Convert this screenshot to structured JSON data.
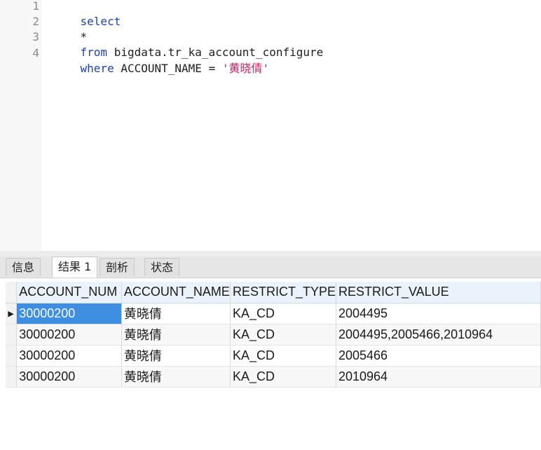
{
  "editor": {
    "line_numbers": [
      "1",
      "2",
      "3",
      "4"
    ],
    "lines": [
      [
        {
          "t": "select",
          "c": "kw"
        }
      ],
      [
        {
          "t": "*",
          "c": "plain"
        }
      ],
      [
        {
          "t": "from",
          "c": "kw"
        },
        {
          "t": " bigdata.tr_ka_account_configure",
          "c": "plain"
        }
      ],
      [
        {
          "t": "where",
          "c": "kw"
        },
        {
          "t": " ACCOUNT_NAME = ",
          "c": "plain"
        },
        {
          "t": "'黄晓倩'",
          "c": "str"
        }
      ]
    ]
  },
  "tabs": [
    "信息",
    "结果 1",
    "剖析",
    "状态"
  ],
  "active_tab": 1,
  "grid": {
    "columns": [
      "ACCOUNT_NUM",
      "ACCOUNT_NAME",
      "RESTRICT_TYPE",
      "RESTRICT_VALUE"
    ],
    "rows": [
      [
        "30000200",
        "黄晓倩",
        "KA_CD",
        "2004495"
      ],
      [
        "30000200",
        "黄晓倩",
        "KA_CD",
        "2004495,2005466,2010964"
      ],
      [
        "30000200",
        "黄晓倩",
        "KA_CD",
        "2005466"
      ],
      [
        "30000200",
        "黄晓倩",
        "KA_CD",
        "2010964"
      ]
    ],
    "current_row_marker": "▶",
    "current_row": 0
  },
  "colors": {
    "keyword": "#1a3fbf",
    "string": "#d0205a",
    "selection": "#3e8fe2",
    "header": "#eaf2fb"
  }
}
